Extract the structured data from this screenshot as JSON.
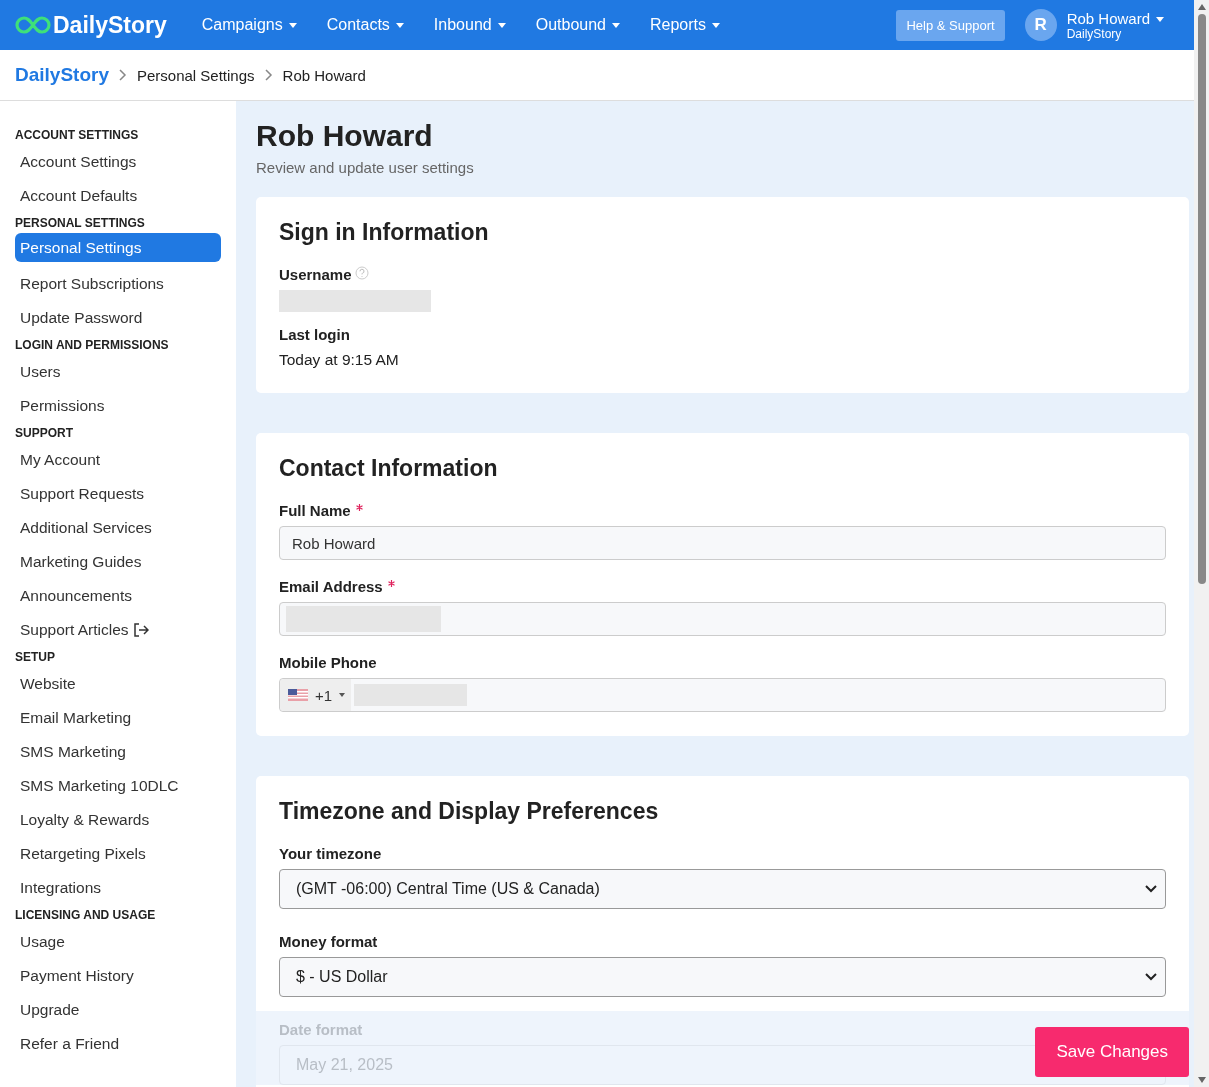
{
  "topbar": {
    "logo": "DailyStory",
    "menus": [
      {
        "label": "Campaigns"
      },
      {
        "label": "Contacts"
      },
      {
        "label": "Inbound"
      },
      {
        "label": "Outbound"
      },
      {
        "label": "Reports"
      }
    ],
    "help_button": "Help & Support",
    "user": {
      "avatar_letter": "R",
      "name": "Rob Howard",
      "company": "DailyStory"
    }
  },
  "breadcrumb": [
    "DailyStory",
    "Personal Settings",
    "Rob Howard"
  ],
  "sidebar": {
    "sections": [
      {
        "heading": "ACCOUNT SETTINGS",
        "items": [
          {
            "label": "Account Settings",
            "selected": false,
            "external": false
          },
          {
            "label": "Account Defaults",
            "selected": false,
            "external": false
          }
        ]
      },
      {
        "heading": "PERSONAL SETTINGS",
        "items": [
          {
            "label": "Personal Settings",
            "selected": true,
            "external": false
          },
          {
            "label": "Report Subscriptions",
            "selected": false,
            "external": false
          },
          {
            "label": "Update Password",
            "selected": false,
            "external": false
          }
        ]
      },
      {
        "heading": "LOGIN AND PERMISSIONS",
        "items": [
          {
            "label": "Users",
            "selected": false,
            "external": false
          },
          {
            "label": "Permissions",
            "selected": false,
            "external": false
          }
        ]
      },
      {
        "heading": "SUPPORT",
        "items": [
          {
            "label": "My Account",
            "selected": false,
            "external": false
          },
          {
            "label": "Support Requests",
            "selected": false,
            "external": false
          },
          {
            "label": "Additional Services",
            "selected": false,
            "external": false
          },
          {
            "label": "Marketing Guides",
            "selected": false,
            "external": false
          },
          {
            "label": "Announcements",
            "selected": false,
            "external": false
          },
          {
            "label": "Support Articles",
            "selected": false,
            "external": true
          }
        ]
      },
      {
        "heading": "SETUP",
        "items": [
          {
            "label": "Website",
            "selected": false,
            "external": false
          },
          {
            "label": "Email Marketing",
            "selected": false,
            "external": false
          },
          {
            "label": "SMS Marketing",
            "selected": false,
            "external": false
          },
          {
            "label": "SMS Marketing 10DLC",
            "selected": false,
            "external": false
          },
          {
            "label": "Loyalty & Rewards",
            "selected": false,
            "external": false
          },
          {
            "label": "Retargeting Pixels",
            "selected": false,
            "external": false
          },
          {
            "label": "Integrations",
            "selected": false,
            "external": false
          }
        ]
      },
      {
        "heading": "LICENSING AND USAGE",
        "items": [
          {
            "label": "Usage",
            "selected": false,
            "external": false
          },
          {
            "label": "Payment History",
            "selected": false,
            "external": false
          },
          {
            "label": "Upgrade",
            "selected": false,
            "external": false
          },
          {
            "label": "Refer a Friend",
            "selected": false,
            "external": false
          }
        ]
      }
    ]
  },
  "page": {
    "title": "Rob Howard",
    "subtitle": "Review and update user settings"
  },
  "sign_in": {
    "title": "Sign in Information",
    "username_label": "Username",
    "last_login_label": "Last login",
    "last_login_value": "Today at 9:15 AM"
  },
  "contact": {
    "title": "Contact Information",
    "fields": [
      {
        "label": "Full Name",
        "required": true,
        "kind": "text",
        "value": "Rob Howard"
      },
      {
        "label": "Email Address",
        "required": true,
        "kind": "redacted"
      },
      {
        "label": "Mobile Phone",
        "required": false,
        "kind": "phone",
        "country_code": "+1"
      }
    ]
  },
  "preferences": {
    "title": "Timezone and Display Preferences",
    "fields": [
      {
        "label": "Your timezone",
        "kind": "select",
        "value": "(GMT -06:00) Central Time (US & Canada)"
      },
      {
        "label": "Money format",
        "kind": "select",
        "value": "$ - US Dollar"
      },
      {
        "label": "Date format",
        "kind": "faded",
        "value": "May 21, 2025"
      }
    ]
  },
  "save_button": "Save Changes"
}
